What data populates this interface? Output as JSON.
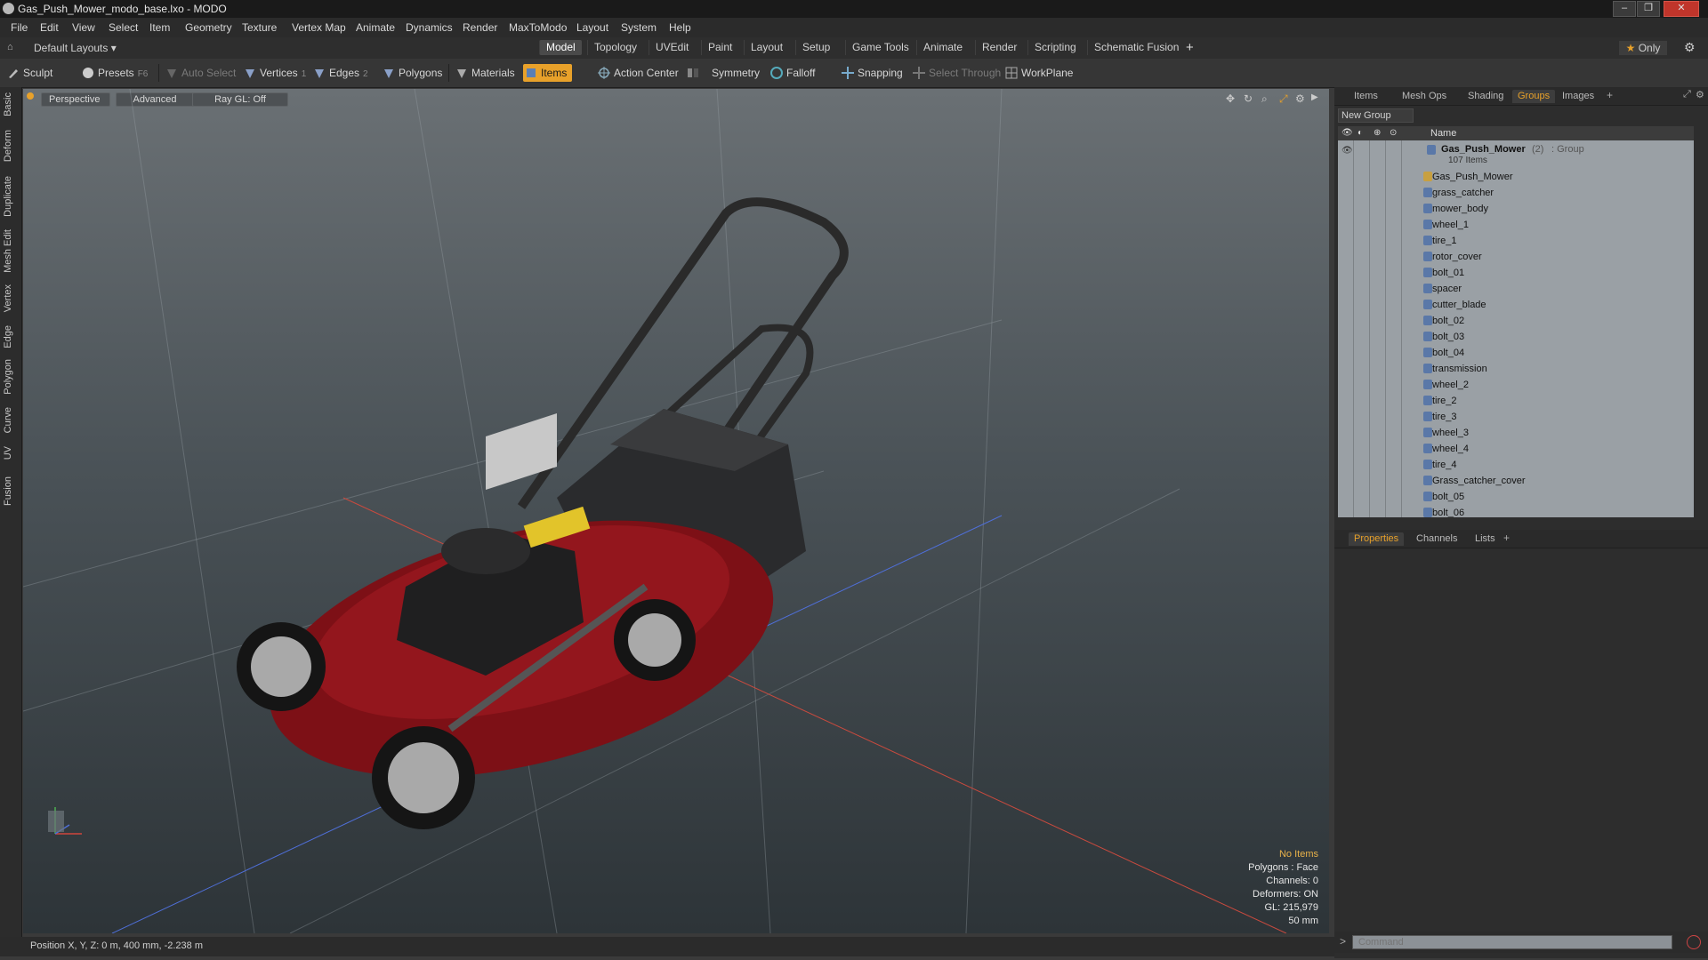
{
  "window": {
    "title": "Gas_Push_Mower_modo_base.lxo - MODO",
    "icon": "modo-icon"
  },
  "menu": [
    "File",
    "Edit",
    "View",
    "Select",
    "Item",
    "Geometry",
    "Texture",
    "Vertex Map",
    "Animate",
    "Dynamics",
    "Render",
    "MaxToModo",
    "Layout",
    "System",
    "Help"
  ],
  "layout_selector": "Default Layouts",
  "layout_tabs": [
    "Model",
    "Topology",
    "UVEdit",
    "Paint",
    "Layout",
    "Setup",
    "Game Tools",
    "Animate",
    "Render",
    "Scripting",
    "Schematic Fusion"
  ],
  "active_layout_tab": "Model",
  "only_label": "Only",
  "toolbar": {
    "sculpt": "Sculpt",
    "presets": "Presets",
    "presets_key": "F6",
    "auto_select": "Auto Select",
    "vertices": "Vertices",
    "vertices_key": "1",
    "edges": "Edges",
    "edges_key": "2",
    "polygons": "Polygons",
    "materials": "Materials",
    "items": "Items",
    "action_center": "Action Center",
    "symmetry": "Symmetry",
    "falloff": "Falloff",
    "snapping": "Snapping",
    "select_through": "Select Through",
    "workplane": "WorkPlane"
  },
  "left_tabs": [
    "Basic",
    "Deform",
    "Duplicate",
    "Mesh Edit",
    "Vertex",
    "Edge",
    "Polygon",
    "Curve",
    "UV",
    "Fusion"
  ],
  "viewport": {
    "view_mode": "Perspective",
    "shading": "Advanced",
    "raygl": "Ray GL: Off",
    "info": {
      "selection": "No Items",
      "polygons": "Polygons : Face",
      "channels": "Channels: 0",
      "deformers": "Deformers: ON",
      "gl": "GL: 215,979",
      "scale": "50 mm"
    }
  },
  "status": {
    "position": "Position X, Y, Z:  0 m, 400 mm, -2.238 m"
  },
  "right_tabs_top": [
    "Items",
    "Mesh Ops",
    "Shading",
    "Groups",
    "Images"
  ],
  "active_right_tab": "Groups",
  "groups_panel": {
    "new_group": "New Group",
    "name_header": "Name",
    "group_name": "Gas_Push_Mower",
    "group_count": "(2)",
    "group_type": ": Group",
    "group_items": "107 Items",
    "children": [
      "Gas_Push_Mower",
      "grass_catcher",
      "mower_body",
      "wheel_1",
      "tire_1",
      "rotor_cover",
      "bolt_01",
      "spacer",
      "cutter_blade",
      "bolt_02",
      "bolt_03",
      "bolt_04",
      "transmission",
      "wheel_2",
      "tire_2",
      "tire_3",
      "wheel_3",
      "wheel_4",
      "tire_4",
      "Grass_catcher_cover",
      "bolt_05",
      "bolt_06"
    ]
  },
  "right_tabs_bottom": [
    "Properties",
    "Channels",
    "Lists"
  ],
  "active_bottom_tab": "Properties",
  "command": {
    "placeholder": "Command"
  }
}
